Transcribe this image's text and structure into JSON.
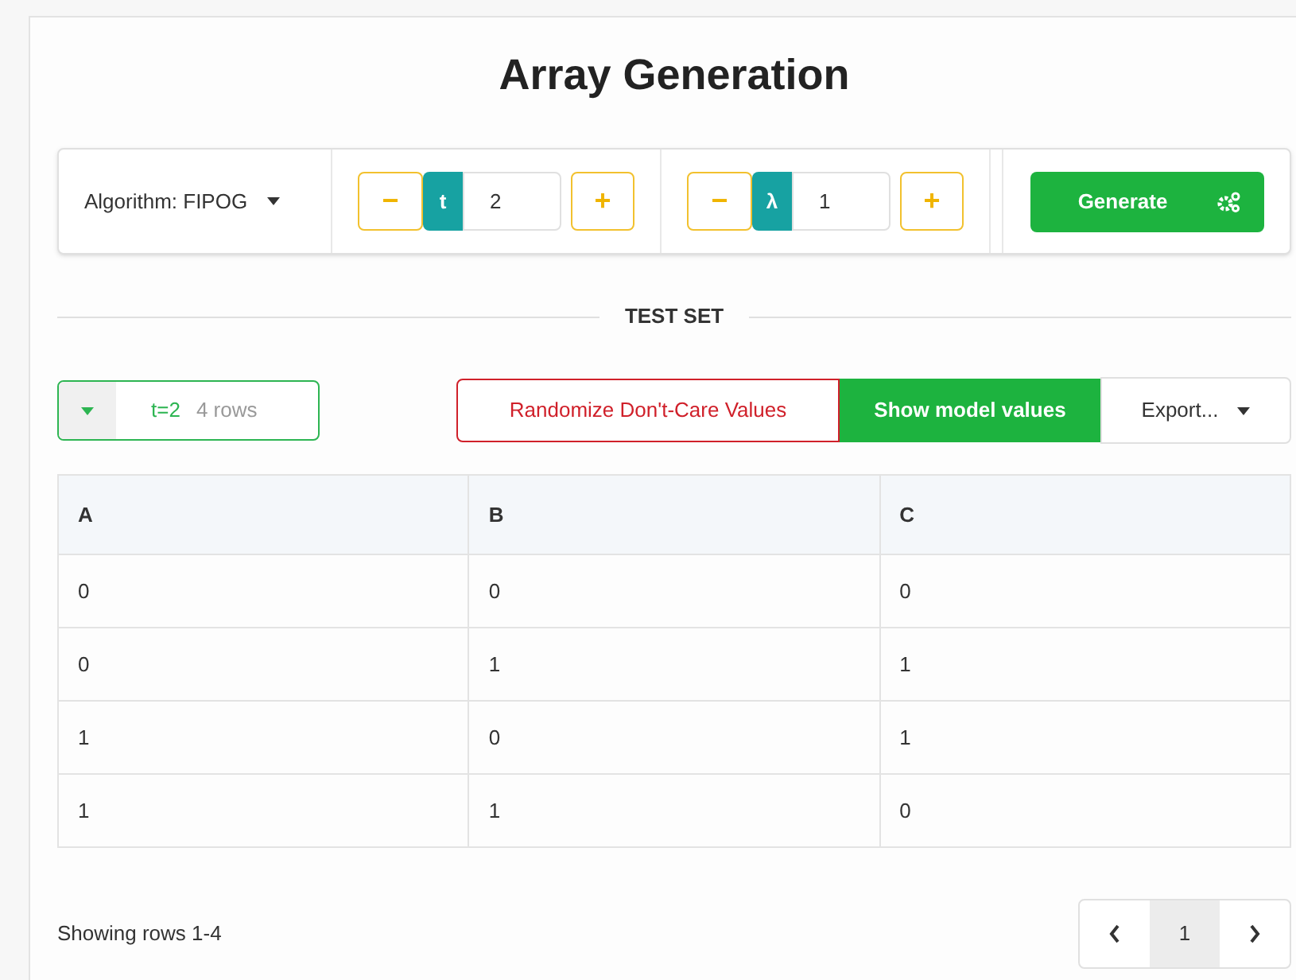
{
  "title": "Array Generation",
  "toolbar": {
    "algorithm": "Algorithm: FIPOG",
    "steppers": [
      {
        "minus": "−",
        "label": "t",
        "value": "2",
        "plus": "+"
      },
      {
        "minus": "−",
        "label": "λ",
        "value": "1",
        "plus": "+"
      }
    ],
    "generate": "Generate"
  },
  "section_heading": "TEST SET",
  "test_set_selector": {
    "strength": "t=2",
    "rows": "4 rows"
  },
  "actions": {
    "randomize": "Randomize Don't-Care Values",
    "show_model": "Show model values",
    "export": "Export..."
  },
  "table": {
    "columns": [
      "A",
      "B",
      "C"
    ],
    "rows": [
      [
        "0",
        "0",
        "0"
      ],
      [
        "0",
        "1",
        "1"
      ],
      [
        "1",
        "0",
        "1"
      ],
      [
        "1",
        "1",
        "0"
      ]
    ]
  },
  "footer": "Showing rows 1-4",
  "pagination": {
    "pages": [
      {
        "label": "1",
        "selected": true
      }
    ]
  }
}
